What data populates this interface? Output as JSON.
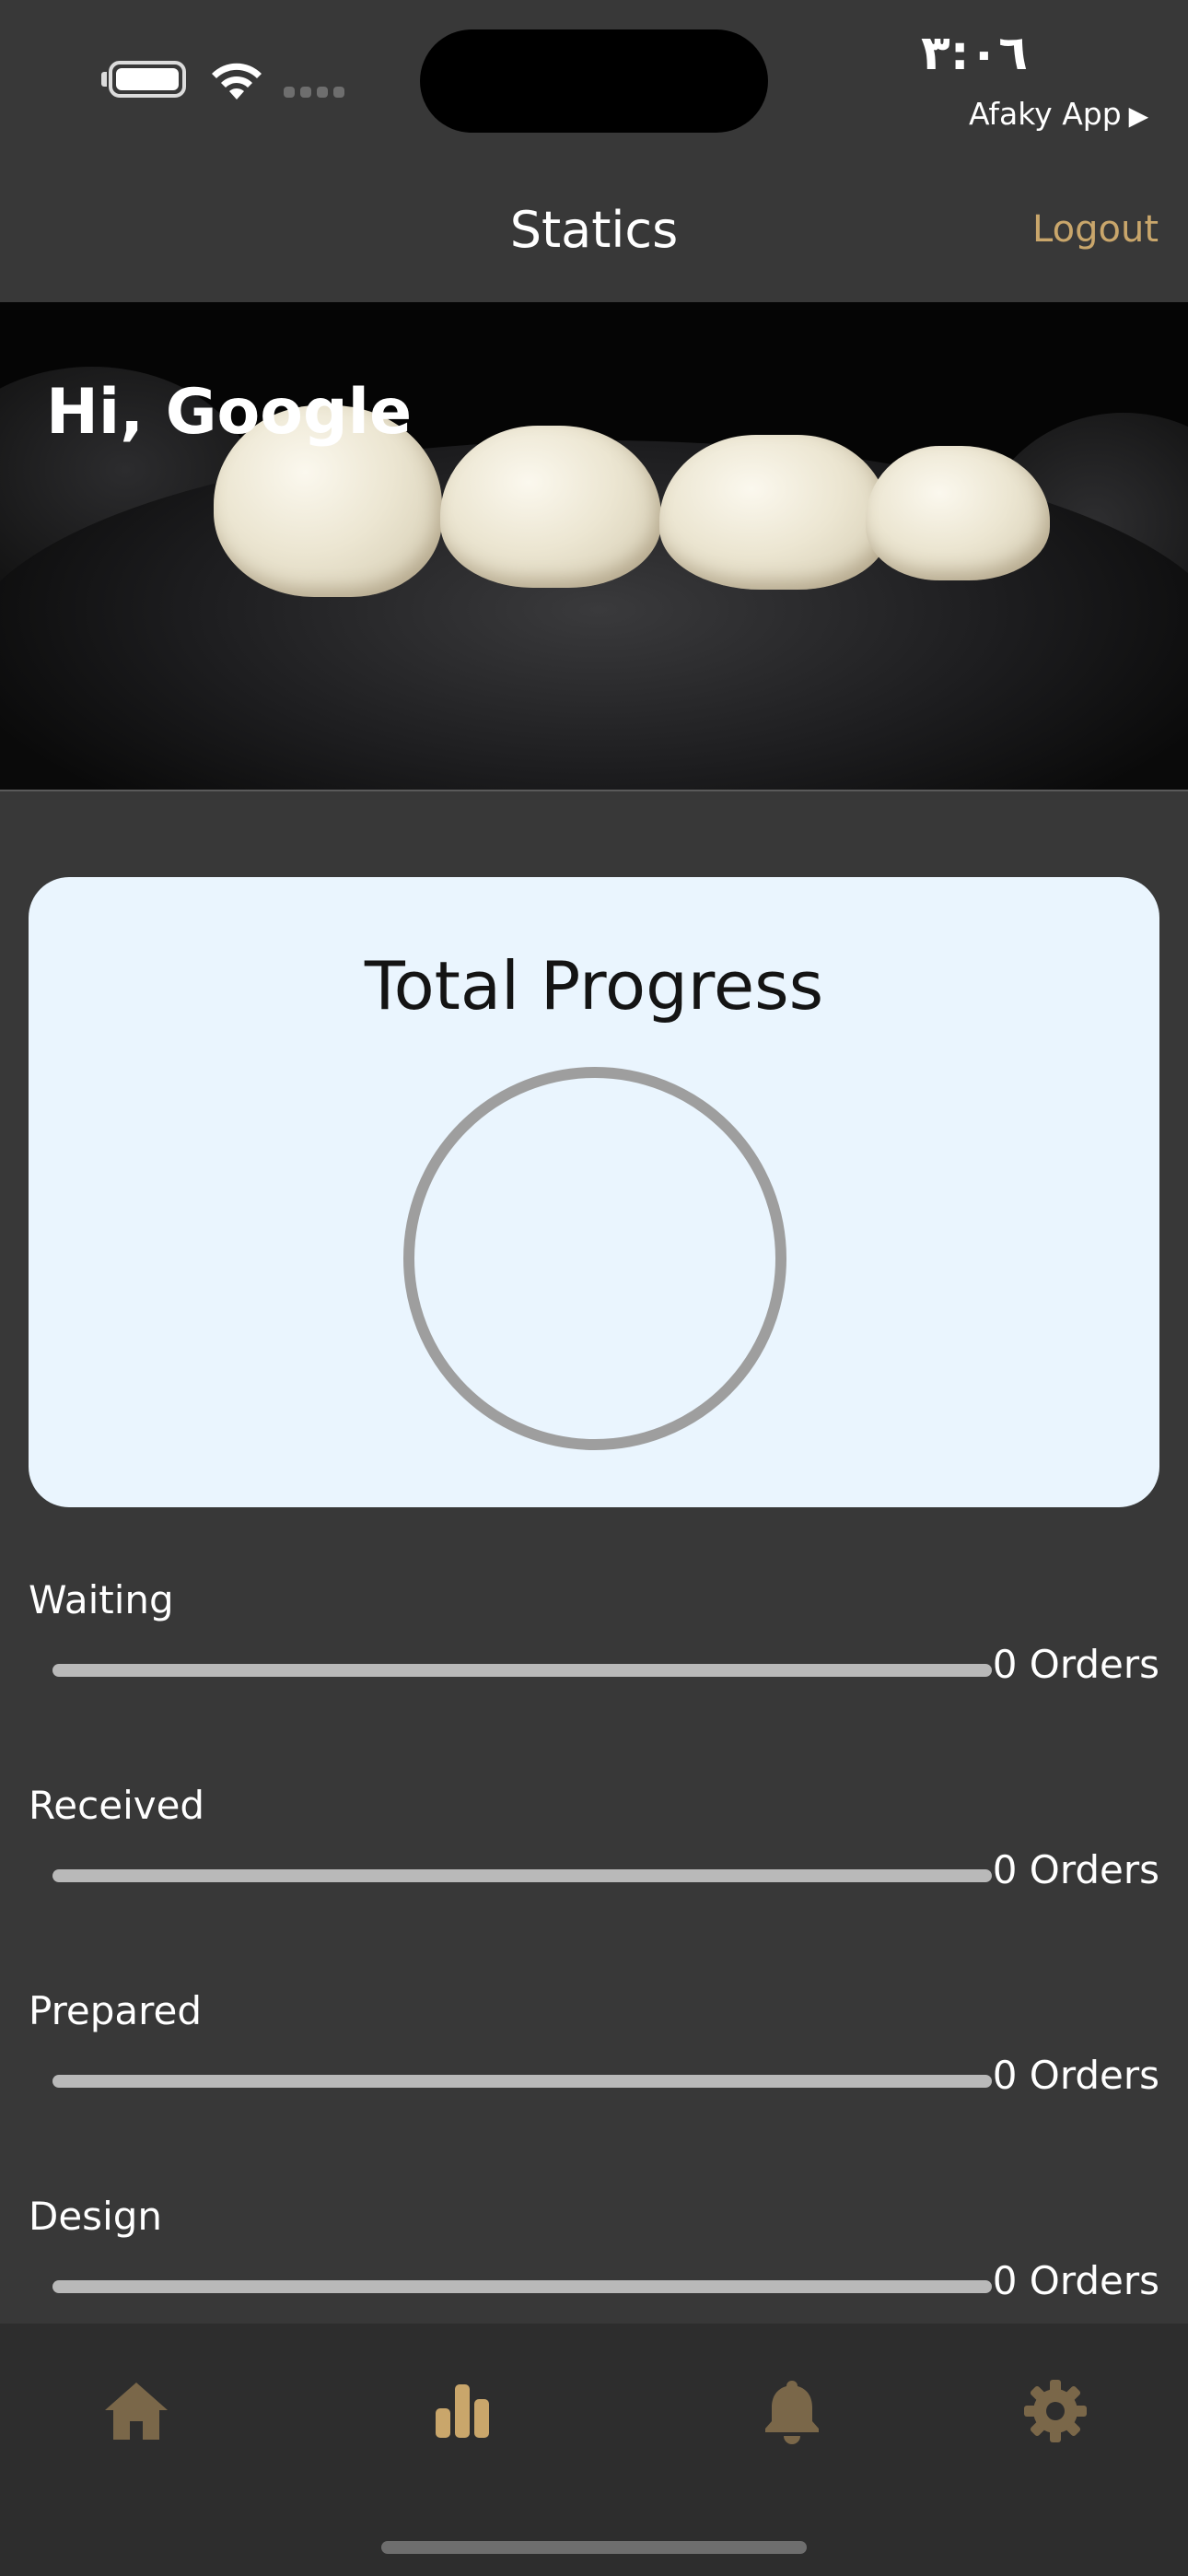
{
  "status_bar": {
    "time": "٣:٠٦",
    "back_app": "Afaky App",
    "back_arrow": "▶",
    "battery_icon": "battery-icon",
    "wifi_icon": "wifi-icon",
    "signal_icon": "cellular-signal-icon"
  },
  "nav": {
    "title": "Statics",
    "logout_label": "Logout"
  },
  "hero": {
    "greeting": "Hi, Google",
    "image": "dental-crowns-photo"
  },
  "progress_card": {
    "title": "Total Progress",
    "progress_fraction": 0
  },
  "status_rows": [
    {
      "label": "Waiting",
      "count": "0 Orders",
      "fraction": 0
    },
    {
      "label": "Received",
      "count": "0 Orders",
      "fraction": 0
    },
    {
      "label": "Prepared",
      "count": "0 Orders",
      "fraction": 0
    },
    {
      "label": "Design",
      "count": "0 Orders",
      "fraction": 0
    }
  ],
  "tab_bar": {
    "tabs": [
      {
        "name": "home",
        "icon": "home-icon",
        "active": false
      },
      {
        "name": "statistics",
        "icon": "bar-chart-icon",
        "active": true
      },
      {
        "name": "notifications",
        "icon": "bell-icon",
        "active": false
      },
      {
        "name": "settings",
        "icon": "gear-icon",
        "active": false
      }
    ]
  },
  "colors": {
    "background": "#383838",
    "accent": "#c9a66b",
    "card_background": "#eaf5fe",
    "tab_inactive": "#7a6749",
    "tab_active": "#c9a66b",
    "track": "#b9b9b9",
    "ring": "#9e9e9e"
  }
}
